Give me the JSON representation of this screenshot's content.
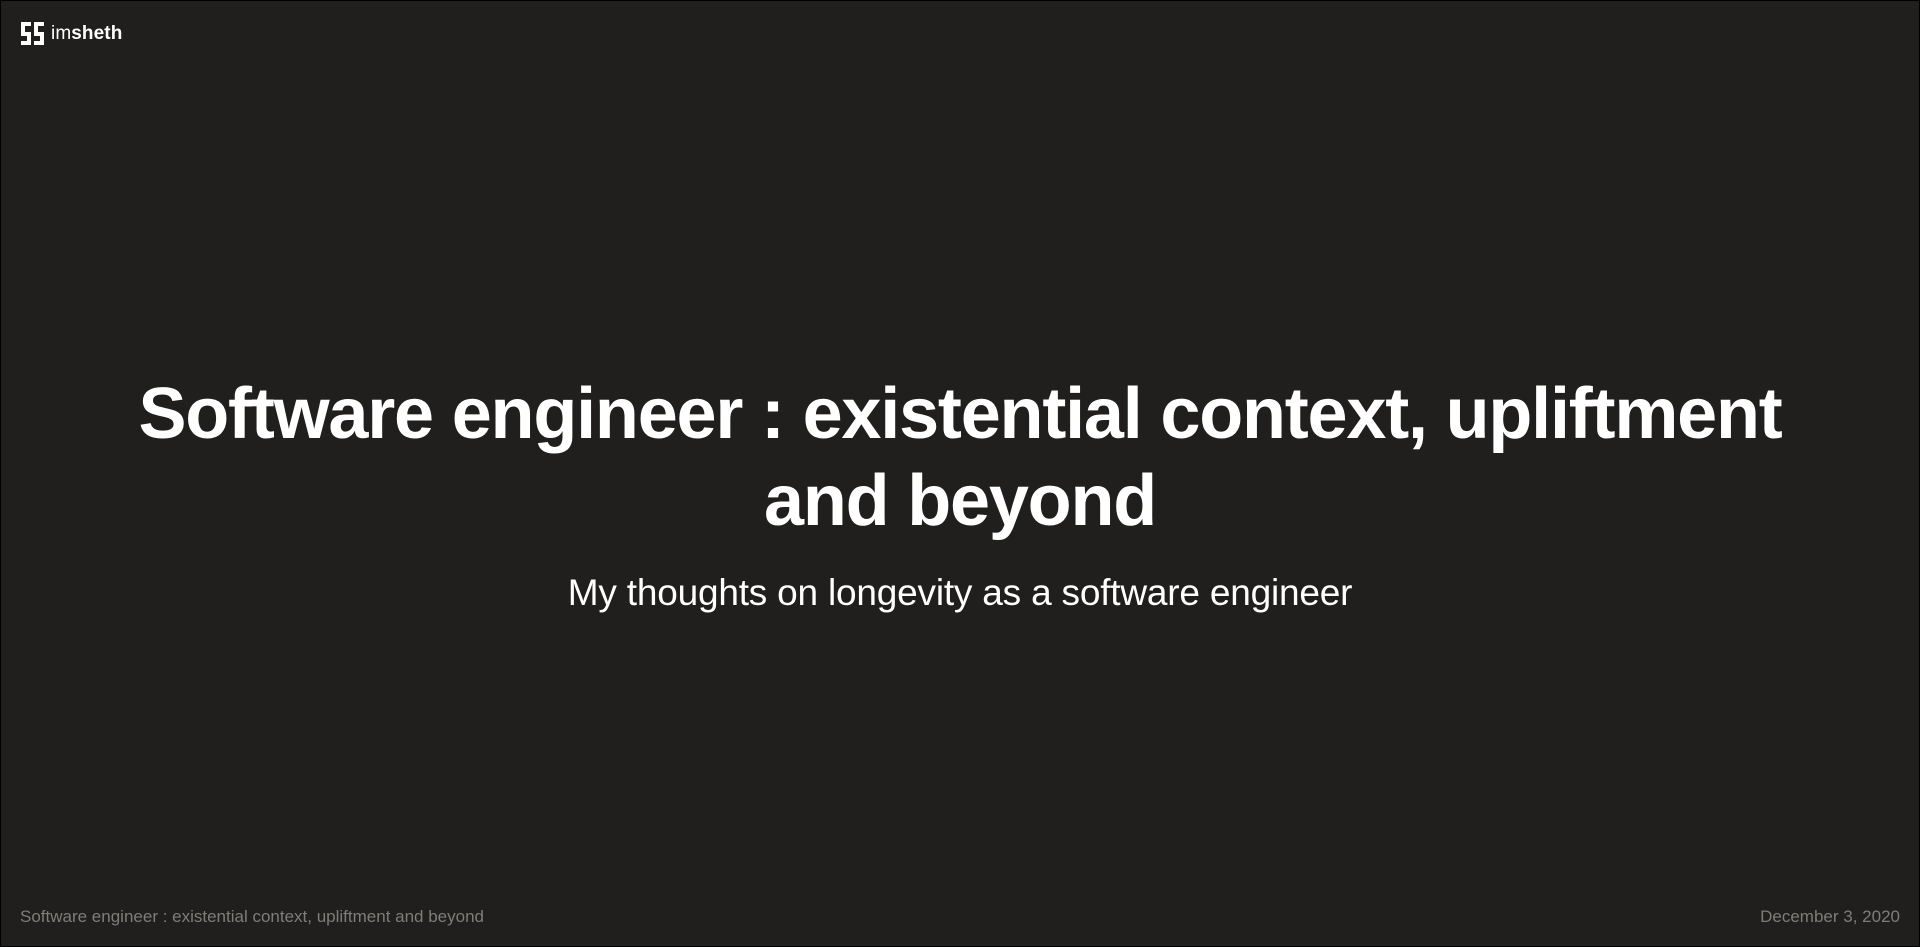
{
  "brand": {
    "logo_icon": "imsheth-monogram-icon",
    "name_prefix": "im",
    "name_suffix": "sheth"
  },
  "hero": {
    "title": "Software engineer : existential context, upliftment and beyond",
    "subtitle": "My thoughts on longevity as a software engineer"
  },
  "footer": {
    "post_title": "Software engineer : existential context, upliftment and beyond",
    "date": "December 3, 2020"
  },
  "colors": {
    "background": "#201f1d",
    "text": "#ffffff",
    "muted_text": "#7e7d7a"
  }
}
